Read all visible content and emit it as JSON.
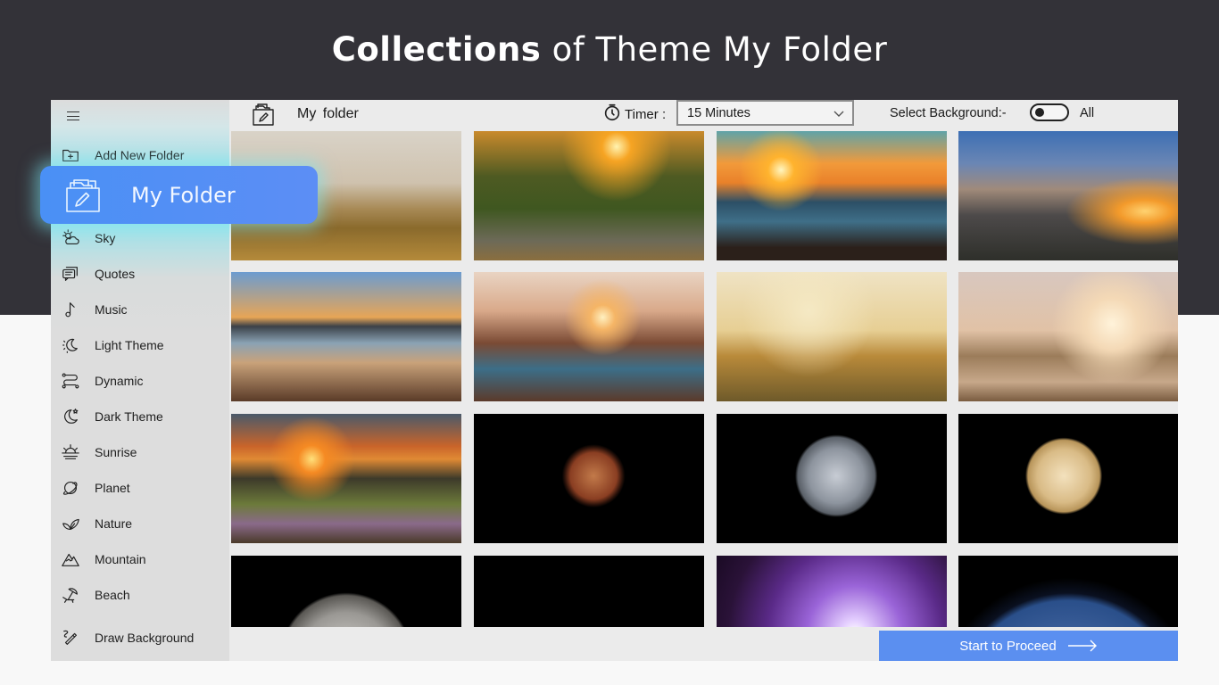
{
  "promo": {
    "title_bold": "Collections",
    "title_rest": "of Theme My Folder"
  },
  "sidebar": {
    "menu_icon": "hamburger-icon",
    "add_folder": {
      "label": "Add New Folder",
      "icon": "folder-plus-icon"
    },
    "selected": {
      "label": "My Folder",
      "icon": "folder-edit-icon"
    },
    "items": [
      {
        "label": "Sky",
        "icon": "sun-cloud-icon"
      },
      {
        "label": "Quotes",
        "icon": "chat-bubbles-icon"
      },
      {
        "label": "Music",
        "icon": "music-note-icon"
      },
      {
        "label": "Light Theme",
        "icon": "moon-sun-icon"
      },
      {
        "label": "Dynamic",
        "icon": "flow-nodes-icon"
      },
      {
        "label": "Dark Theme",
        "icon": "moon-star-icon"
      },
      {
        "label": "Sunrise",
        "icon": "sunrise-icon"
      },
      {
        "label": "Planet",
        "icon": "planet-icon"
      },
      {
        "label": "Nature",
        "icon": "leaves-icon"
      },
      {
        "label": "Mountain",
        "icon": "mountain-icon"
      },
      {
        "label": "Beach",
        "icon": "beach-umbrella-icon"
      }
    ],
    "draw": {
      "label": "Draw Background",
      "icon": "pencil-scribble-icon"
    }
  },
  "header": {
    "folder_title": "My folder",
    "timer_label": "Timer :",
    "timer_value": "15 Minutes",
    "select_bg_label": "Select Background:-",
    "toggle_label": "All",
    "toggle_on": false
  },
  "gallery": {
    "thumbnails": [
      {
        "name": "couple-in-meadow-sunset",
        "bg": "linear-gradient(180deg,#d9d3c8 0%,#cfc2ae 40%,#a88a56 60%,#8a6a2c 75%,#b48a3a 100%)"
      },
      {
        "name": "railway-track-sunset",
        "bg": "radial-gradient(circle at 62% 12%,#fff3b0 0,#f6a423 8%,transparent 30%),linear-gradient(180deg,#c98a2c 0%,#4e5a22 35%,#3f5720 60%,#6d6a58 85%,#8a6e3e 100%)"
      },
      {
        "name": "sunset-over-rocky-sea",
        "bg": "radial-gradient(circle at 28% 30%,#fff6c0 0,#ffb32e 7%,transparent 22%),linear-gradient(180deg,#5fa3a8 0%,#f29a3a 25%,#e9812a 40%,#2c4f66 55%,#3f6f88 70%,#2b201a 90%)"
      },
      {
        "name": "clouds-mountains-sunset",
        "bg": "radial-gradient(ellipse at 85% 62%,#ffd270 0,#f39a2b 10%,transparent 30%),linear-gradient(180deg,#3d6fb4 0%,#6a86b4 25%,#a08a7a 45%,#4d4a4a 65%,#2e2f2a 100%)"
      },
      {
        "name": "wooden-pier-lake",
        "bg": "linear-gradient(180deg,#6c9cd0 0%,#e7a556 35%,#3b4148 42%,#8aa2b4 55%,#c9a27a 70%,#5a3b28 100%)"
      },
      {
        "name": "canyon-river-sunburst",
        "bg": "radial-gradient(circle at 56% 35%,#fff0c0 0,#f5b566 8%,transparent 25%),linear-gradient(180deg,#e9d4c3 0%,#d9a98a 30%,#7a4a34 55%,#3c6e88 75%,#5b3a2a 100%)"
      },
      {
        "name": "poppies-field",
        "bg": "radial-gradient(circle at 40% 30%,#f5e9c4 0,transparent 40%),linear-gradient(180deg,#efe3c4 0%,#e7cf94 45%,#b98a3a 65%,#6e5a2a 100%)"
      },
      {
        "name": "beach-grass-sunset",
        "bg": "radial-gradient(circle at 70% 40%,#fff3da 0,#f4d9b6 15%,transparent 35%),linear-gradient(180deg,#d8c7bf 0%,#e1c2a6 45%,#9b7c5a 65%,#c7a88a 85%,#7a5c40 100%)"
      },
      {
        "name": "forest-fiery-sunset",
        "bg": "radial-gradient(circle at 35% 35%,#ffe07a 0,#f58a23 8%,transparent 25%),linear-gradient(180deg,#4a5a6a 0%,#c9642a 25%,#e08a34 35%,#3d3a2a 50%,#6c7a3a 70%,#8a6a8a 85%,#4a3a2a 100%)"
      },
      {
        "name": "red-moon-eclipse",
        "bg": "radial-gradient(circle at 52% 48%,#c27a4a 0,#8a3e22 17%,#2a120a 21%,#000 23%,#000 100%)"
      },
      {
        "name": "full-moon-grey",
        "bg": "radial-gradient(circle at 52% 48%,#c7ccd4 0,#8d949e 20%,#5a6068 28%,#000 30%,#000 100%)"
      },
      {
        "name": "full-moon-golden",
        "bg": "radial-gradient(circle at 48% 48%,#f3e1bd 0,#d9bb86 20%,#b8955a 27%,#000 29%,#000 100%)"
      },
      {
        "name": "half-moon-grey",
        "bg": "radial-gradient(circle at 50% 80%,#d8d6d2 0,#9a9894 30%,#5a5854 41%,#000 43%,#000 100%)"
      },
      {
        "name": "crescent-moon",
        "bg": "radial-gradient(circle at 58% 95%,#d4ccc0 0,#8a8274 6%,#000 9%,#000 100%)"
      },
      {
        "name": "solar-flare-sun",
        "bg": "radial-gradient(circle at 60% 60%,#ffffff 0,#e5d0ff 8%,#9a64d8 30%,#5a2a88 55%,#2a1238 80%,#1a0a24 100%)"
      },
      {
        "name": "planet-earth",
        "bg": "radial-gradient(circle at 50% 120%,#6b8ab0 0,#3c5f9a 40%,#2a4f8a 58%,#0a1020 62%,#000 70%)"
      }
    ]
  },
  "footer": {
    "proceed_label": "Start to Proceed",
    "proceed_icon": "arrow-right-icon"
  },
  "colors": {
    "accent": "#5b8ff0",
    "selected_pill": "#4a90f5",
    "top_band": "#333238"
  }
}
